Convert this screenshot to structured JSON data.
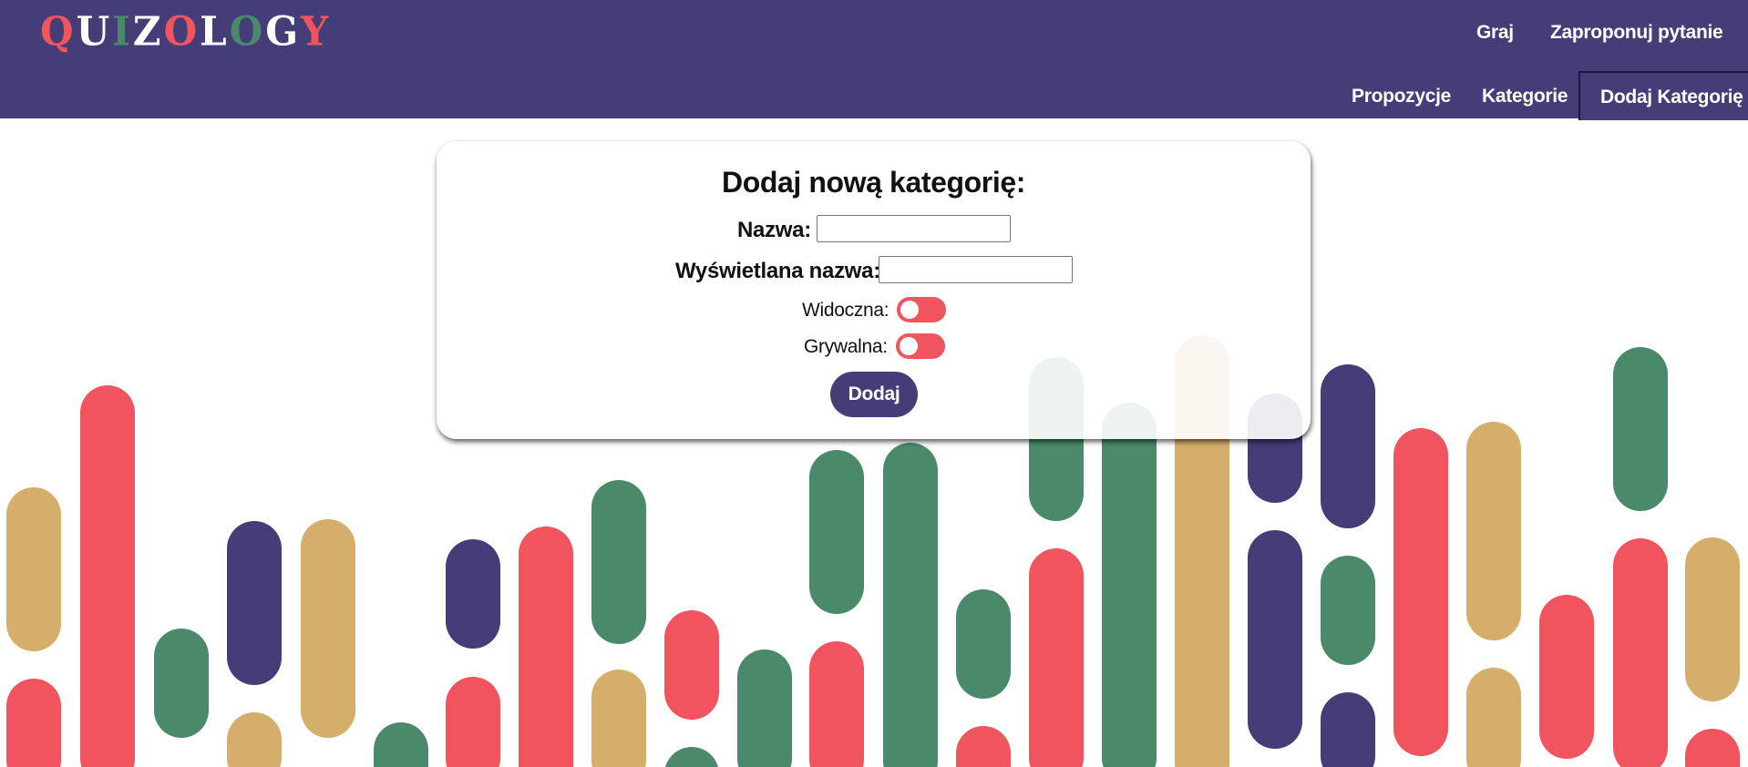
{
  "brand": {
    "logo_letters": [
      {
        "ch": "Q",
        "color": "#f0545f"
      },
      {
        "ch": "U",
        "color": "#ffffff"
      },
      {
        "ch": "I",
        "color": "#4a8a6a"
      },
      {
        "ch": "Z",
        "color": "#ffffff"
      },
      {
        "ch": "O",
        "color": "#f0545f"
      },
      {
        "ch": "L",
        "color": "#ffffff"
      },
      {
        "ch": "O",
        "color": "#4a8a6a"
      },
      {
        "ch": "G",
        "color": "#ffffff"
      },
      {
        "ch": "Y",
        "color": "#f0545f"
      }
    ]
  },
  "nav": {
    "top": [
      "Graj",
      "Zaproponuj pytanie"
    ],
    "bottom": [
      "Propozycje",
      "Kategorie",
      "Dodaj Kategorię"
    ],
    "active": "Dodaj Kategorię"
  },
  "form": {
    "title": "Dodaj nową kategorię:",
    "name_label": "Nazwa:",
    "name_value": "",
    "display_label": "Wyświetlana nazwa:",
    "display_value": "",
    "visible_label": "Widoczna:",
    "visible_on": false,
    "playable_label": "Grywalna:",
    "playable_on": false,
    "submit": "Dodaj"
  },
  "colors": {
    "primary": "#443d78",
    "red": "#f0545f",
    "green": "#4a8a6a",
    "gold": "#d6ae6c"
  }
}
